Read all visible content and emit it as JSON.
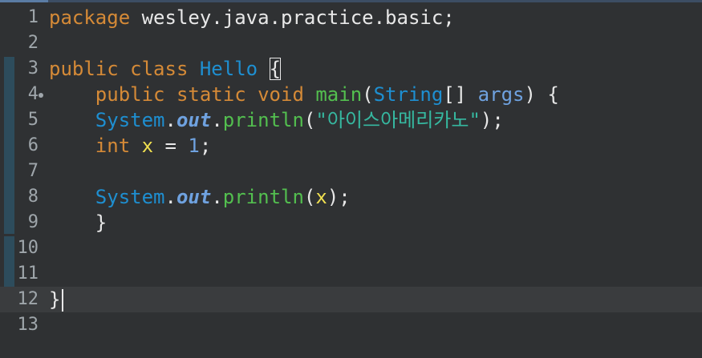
{
  "editor": {
    "lines": [
      {
        "no": "1",
        "tokens": [
          {
            "t": "kw",
            "v": "package"
          },
          {
            "t": "plain",
            "v": " wesley.java.practice.basic;"
          }
        ]
      },
      {
        "no": "2",
        "tokens": []
      },
      {
        "no": "3",
        "tokens": [
          {
            "t": "kw",
            "v": "public"
          },
          {
            "t": "plain",
            "v": " "
          },
          {
            "t": "kw",
            "v": "class"
          },
          {
            "t": "plain",
            "v": " "
          },
          {
            "t": "cls",
            "v": "Hello"
          },
          {
            "t": "plain",
            "v": " "
          },
          {
            "t": "brace",
            "v": "{"
          }
        ]
      },
      {
        "no": "4",
        "fold": true,
        "tokens": [
          {
            "t": "plain",
            "v": "    "
          },
          {
            "t": "kw",
            "v": "public"
          },
          {
            "t": "plain",
            "v": " "
          },
          {
            "t": "kw",
            "v": "static"
          },
          {
            "t": "plain",
            "v": " "
          },
          {
            "t": "kw",
            "v": "void"
          },
          {
            "t": "plain",
            "v": " "
          },
          {
            "t": "mth",
            "v": "main"
          },
          {
            "t": "plain",
            "v": "("
          },
          {
            "t": "cls",
            "v": "String"
          },
          {
            "t": "plain",
            "v": "[] "
          },
          {
            "t": "var",
            "v": "args"
          },
          {
            "t": "plain",
            "v": ") {"
          }
        ]
      },
      {
        "no": "5",
        "tokens": [
          {
            "t": "plain",
            "v": "    "
          },
          {
            "t": "cls",
            "v": "System"
          },
          {
            "t": "plain",
            "v": "."
          },
          {
            "t": "fld",
            "v": "out"
          },
          {
            "t": "plain",
            "v": "."
          },
          {
            "t": "mth",
            "v": "println"
          },
          {
            "t": "plain",
            "v": "("
          },
          {
            "t": "str",
            "v": "\"아이스아메리카노\""
          },
          {
            "t": "plain",
            "v": ");"
          }
        ]
      },
      {
        "no": "6",
        "tokens": [
          {
            "t": "plain",
            "v": "    "
          },
          {
            "t": "kw",
            "v": "int"
          },
          {
            "t": "plain",
            "v": " "
          },
          {
            "t": "loc",
            "v": "x"
          },
          {
            "t": "plain",
            "v": " = "
          },
          {
            "t": "num",
            "v": "1"
          },
          {
            "t": "plain",
            "v": ";"
          }
        ]
      },
      {
        "no": "7",
        "tokens": []
      },
      {
        "no": "8",
        "tokens": [
          {
            "t": "plain",
            "v": "    "
          },
          {
            "t": "cls",
            "v": "System"
          },
          {
            "t": "plain",
            "v": "."
          },
          {
            "t": "fld",
            "v": "out"
          },
          {
            "t": "plain",
            "v": "."
          },
          {
            "t": "mth",
            "v": "println"
          },
          {
            "t": "plain",
            "v": "("
          },
          {
            "t": "loc",
            "v": "x"
          },
          {
            "t": "plain",
            "v": ");"
          }
        ]
      },
      {
        "no": "9",
        "tokens": [
          {
            "t": "plain",
            "v": "    }"
          }
        ]
      },
      {
        "no": "10",
        "tokens": []
      },
      {
        "no": "11",
        "tokens": []
      },
      {
        "no": "12",
        "current": true,
        "tokens": [
          {
            "t": "plain",
            "v": "}"
          },
          {
            "t": "caret",
            "v": ""
          }
        ]
      },
      {
        "no": "13",
        "tokens": []
      }
    ]
  }
}
